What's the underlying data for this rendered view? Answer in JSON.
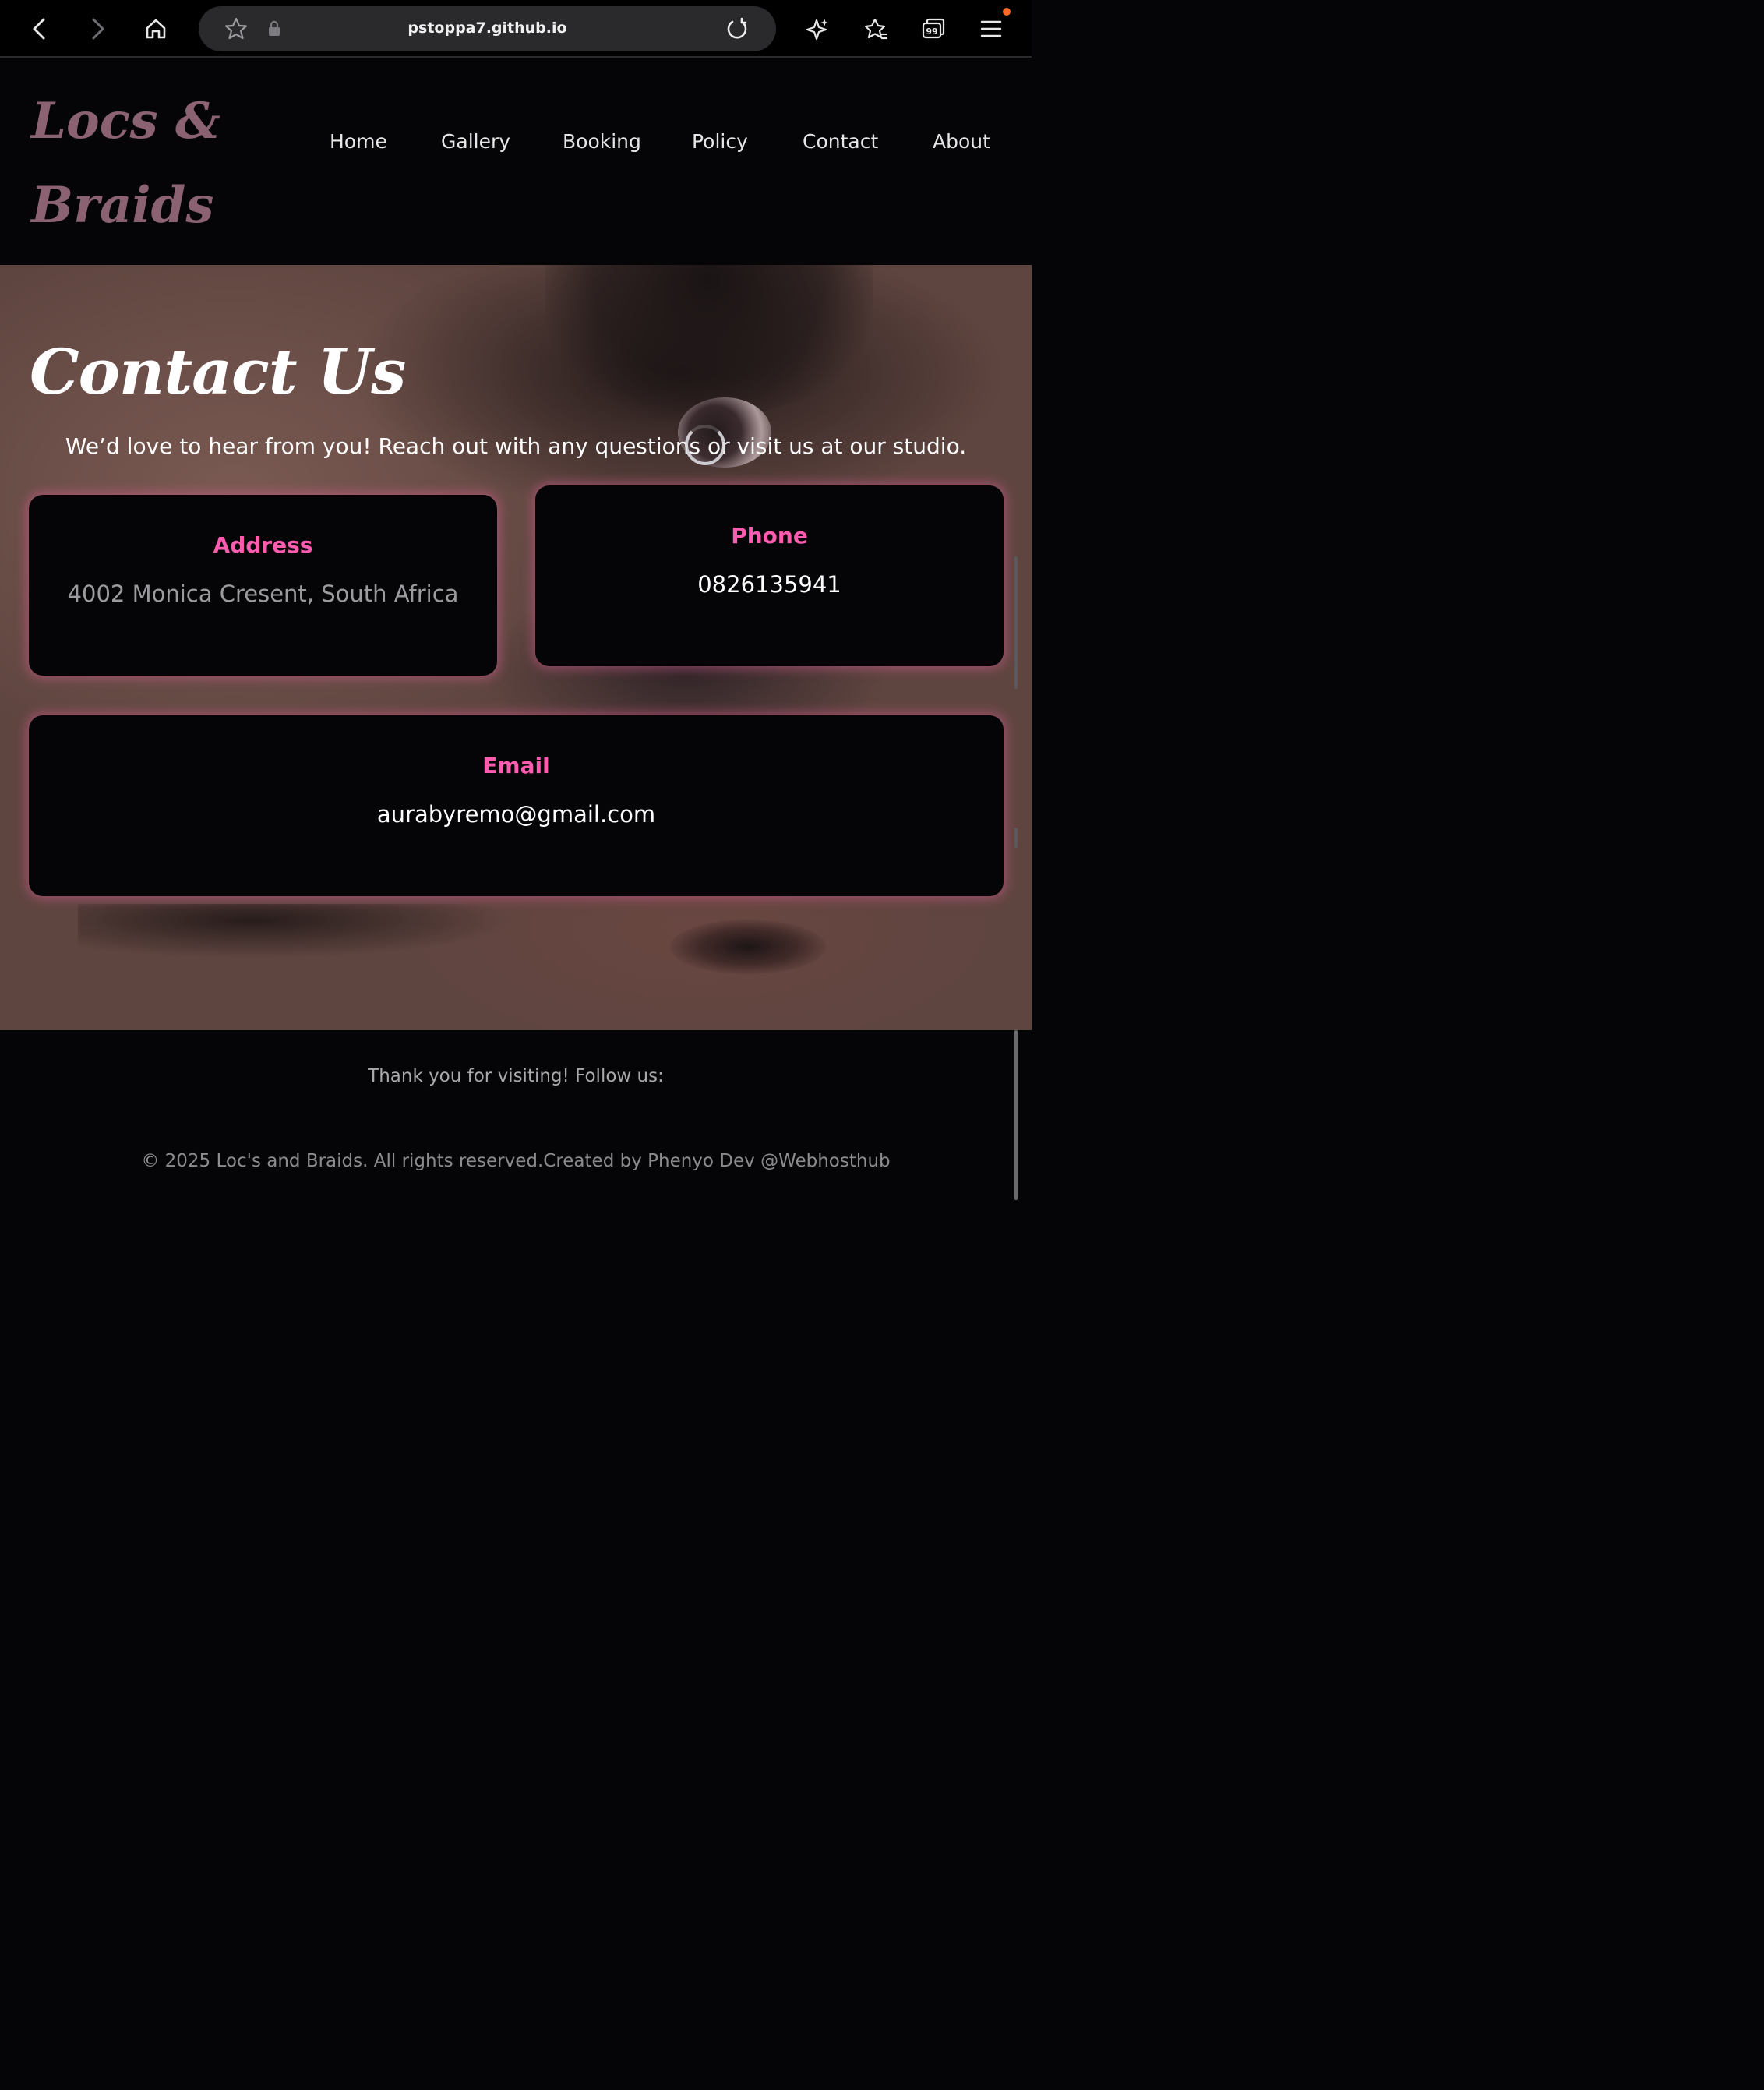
{
  "browser": {
    "url": "pstoppa7.github.io",
    "icons": {
      "back": "chevron-left-icon",
      "forward": "chevron-right-icon",
      "home": "home-icon",
      "bookmark": "star-icon",
      "lock": "lock-icon",
      "reload": "reload-icon",
      "ai": "sparkle-icon",
      "favorites": "favorites-icon",
      "tabs": "tabs-icon",
      "menu": "hamburger-menu-icon"
    }
  },
  "header": {
    "logo_line1": "Locs &",
    "logo_line2": "Braids",
    "nav": [
      "Home",
      "Gallery",
      "Booking",
      "Policy",
      "Contact",
      "About"
    ]
  },
  "main": {
    "title": "Contact Us",
    "intro": "We’d love to hear from you! Reach out with any questions or visit us at our studio.",
    "cards": {
      "address": {
        "heading": "Address",
        "value": "4002 Monica Cresent, South Africa"
      },
      "phone": {
        "heading": "Phone",
        "value": "0826135941"
      },
      "email": {
        "heading": "Email",
        "value": "aurabyremo@gmail.com"
      }
    }
  },
  "footer": {
    "thanks": "Thank you for visiting! Follow us:",
    "copyright": "© 2025 Loc's and Braids. All rights reserved.Created by Phenyo Dev @Webhosthub"
  },
  "colors": {
    "accent_pink": "#ff5cb0",
    "logo_mauve": "#8a6272",
    "background": "#050507",
    "card_glow": "#e05f96"
  }
}
